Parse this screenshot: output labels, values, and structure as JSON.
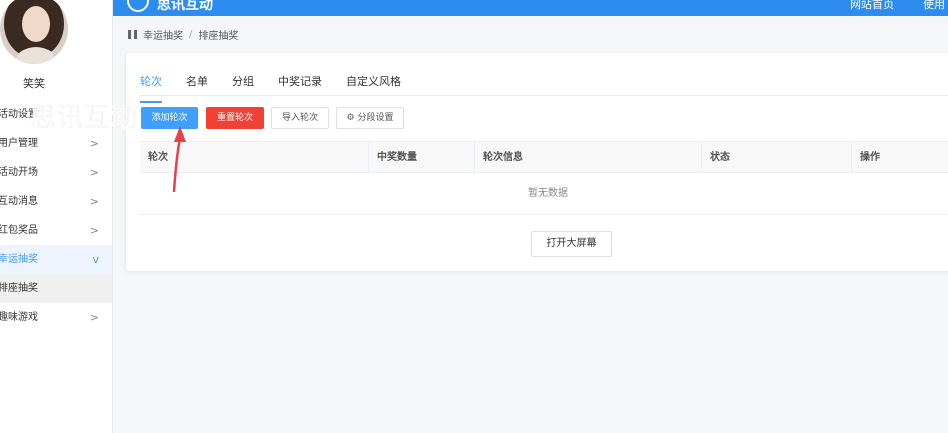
{
  "header": {
    "brand": "思讯互动",
    "nav": [
      "网站首页",
      "使用"
    ]
  },
  "user": {
    "name": "笑笑"
  },
  "sidebar": {
    "items": [
      {
        "label": "活动设置",
        "chevron": ""
      },
      {
        "label": "用户管理",
        "chevron": ">"
      },
      {
        "label": "活动开场",
        "chevron": ">"
      },
      {
        "label": "互动消息",
        "chevron": ">"
      },
      {
        "label": "红包奖品",
        "chevron": ">"
      },
      {
        "label": "幸运抽奖",
        "chevron": "v"
      },
      {
        "label": "排座抽奖",
        "chevron": ""
      },
      {
        "label": "趣味游戏",
        "chevron": ">"
      }
    ]
  },
  "watermark": "思讯互动",
  "breadcrumb": {
    "items": [
      "幸运抽奖",
      "排座抽奖"
    ],
    "separator": "/"
  },
  "tabs": [
    {
      "label": "轮次",
      "active": true
    },
    {
      "label": "名单"
    },
    {
      "label": "分组"
    },
    {
      "label": "中奖记录"
    },
    {
      "label": "自定义风格"
    }
  ],
  "toolbar": {
    "add": "添加轮次",
    "reset": "重置轮次",
    "import": "导入轮次",
    "segment": "分段设置"
  },
  "table": {
    "columns": [
      "轮次",
      "中奖数量",
      "轮次信息",
      "状态",
      "操作"
    ],
    "empty_text": "暂无数据"
  },
  "open_screen": "打开大屏幕",
  "colors": {
    "primary": "#409eff",
    "danger": "#f04134",
    "header": "#2d8cf0"
  }
}
